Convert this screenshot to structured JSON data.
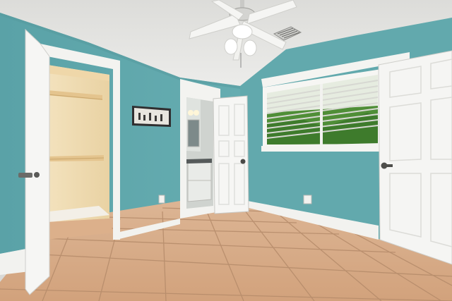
{
  "scene": {
    "description_id": "bedroom-photo",
    "elements": {
      "ceiling_fan": "ceiling-fan",
      "vent": "air-vent",
      "closet": "walk-in-closet",
      "bathroom": "bathroom-doorway",
      "window": "window-with-blinds",
      "artwork": "framed-wall-art",
      "floor": "tile-floor"
    },
    "colors": {
      "wall": "#62a9ad",
      "wall_dark": "#4f9599",
      "ceiling": "#e6e6e3",
      "door": "#f4f4f2",
      "trim": "#f1f1ee",
      "tile": "#d8ad8a",
      "grout": "#b9906f",
      "closet_interior": "#f0ddb4"
    }
  }
}
